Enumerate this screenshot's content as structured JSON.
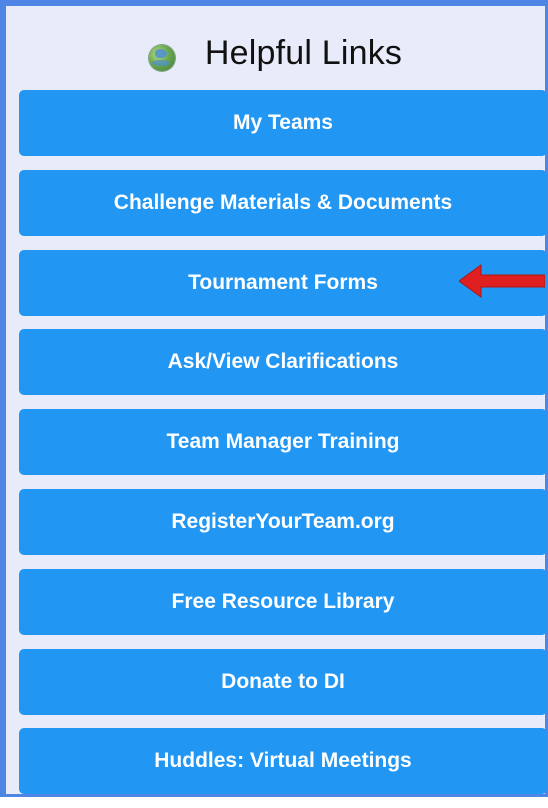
{
  "header": {
    "title": "Helpful Links",
    "icon": "globe-icon"
  },
  "links": [
    {
      "label": "My Teams"
    },
    {
      "label": "Challenge Materials & Documents"
    },
    {
      "label": "Tournament Forms"
    },
    {
      "label": "Ask/View Clarifications"
    },
    {
      "label": "Team Manager Training"
    },
    {
      "label": "RegisterYourTeam.org"
    },
    {
      "label": "Free Resource Library"
    },
    {
      "label": "Donate to DI"
    },
    {
      "label": "Huddles: Virtual Meetings"
    }
  ],
  "annotation": {
    "icon": "red-arrow-icon",
    "points_to": "Tournament Forms",
    "color": "#e02020"
  },
  "colors": {
    "button": "#2196f3",
    "panel_background": "#e8ebfa",
    "border": "#4f86e6"
  }
}
